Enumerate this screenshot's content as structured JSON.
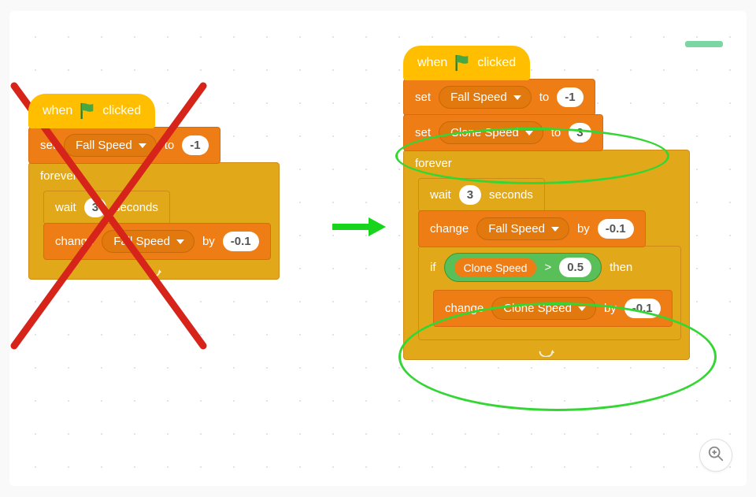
{
  "hat": {
    "when": "when",
    "clicked": "clicked"
  },
  "label": {
    "set": "set",
    "to": "to",
    "change": "change",
    "by": "by",
    "forever": "forever",
    "wait": "wait",
    "seconds": "seconds",
    "if": "if",
    "then": "then",
    "gt": ">"
  },
  "vars": {
    "fall_speed": "Fall Speed",
    "clone_speed": "Clone Speed"
  },
  "left": {
    "set_fall_val": "-1",
    "wait_val": "3",
    "change_fall_val": "-0.1"
  },
  "right": {
    "set_fall_val": "-1",
    "set_clone_val": "3",
    "wait_val": "3",
    "change_fall_val": "-0.1",
    "if_rhs": "0.5",
    "change_clone_val": "-0.1"
  },
  "colors": {
    "accent_green": "#7bd6a4",
    "arrow_green": "#18d41b",
    "highlight_green": "#34d634",
    "red": "#d6241b"
  }
}
